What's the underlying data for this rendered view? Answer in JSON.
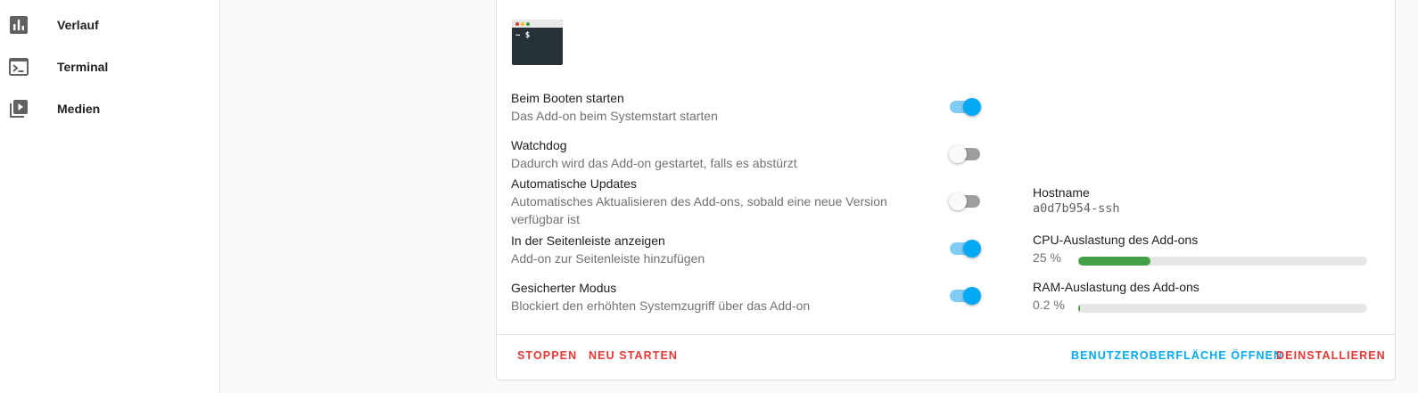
{
  "sidebar": {
    "items": [
      {
        "label": "Verlauf",
        "icon": "chart-box-icon"
      },
      {
        "label": "Terminal",
        "icon": "console-icon"
      },
      {
        "label": "Medien",
        "icon": "play-box-multiple-icon"
      }
    ]
  },
  "addon": {
    "logo_prompt": "~ $",
    "options": [
      {
        "title": "Beim Booten starten",
        "desc": "Das Add-on beim Systemstart starten",
        "enabled": true
      },
      {
        "title": "Watchdog",
        "desc": "Dadurch wird das Add-on gestartet, falls es abstürzt",
        "enabled": false
      },
      {
        "title": "Automatische Updates",
        "desc": "Automatisches Aktualisieren des Add-ons, sobald eine neue Version verfügbar ist",
        "enabled": false
      },
      {
        "title": "In der Seitenleiste anzeigen",
        "desc": "Add-on zur Seitenleiste hinzufügen",
        "enabled": true
      },
      {
        "title": "Gesicherter Modus",
        "desc": "Blockiert den erhöhten Systemzugriff über das Add-on",
        "enabled": true
      }
    ],
    "metrics": {
      "hostname_label": "Hostname",
      "hostname_value": "a0d7b954-ssh",
      "cpu_label": "CPU-Auslastung des Add-ons",
      "cpu_value": "25 %",
      "cpu_percent": 25,
      "ram_label": "RAM-Auslastung des Add-ons",
      "ram_value": "0.2 %",
      "ram_percent": 0.2
    },
    "actions": {
      "stop": "Stoppen",
      "restart": "Neu starten",
      "open_ui": "Benutzeroberfläche öffnen",
      "uninstall": "Deinstallieren"
    }
  },
  "colors": {
    "accent": "#03a9f4",
    "danger": "#e53935",
    "progress_fill": "#43a047",
    "progress_track": "#e6e6e6"
  }
}
